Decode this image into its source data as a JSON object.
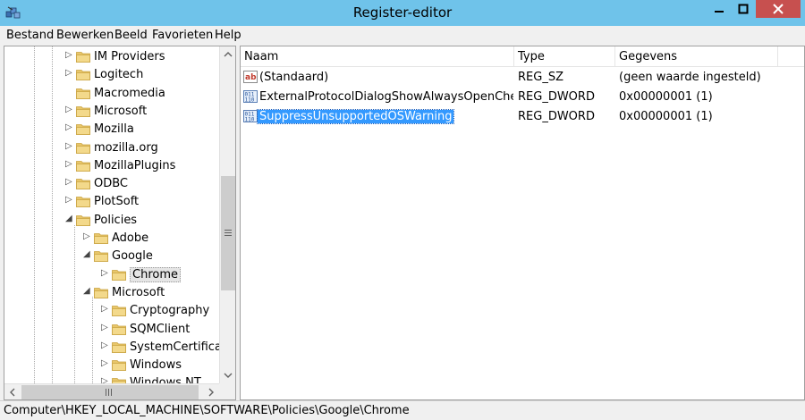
{
  "window": {
    "title": "Register-editor"
  },
  "menu": {
    "items": [
      "Bestand",
      "Bewerken",
      "Beeld",
      "Favorieten",
      "Help"
    ]
  },
  "tree": {
    "items": [
      {
        "label": "IM Providers",
        "expanded": false
      },
      {
        "label": "Logitech",
        "expanded": false
      },
      {
        "label": "Macromedia",
        "expanded": null
      },
      {
        "label": "Microsoft",
        "expanded": false
      },
      {
        "label": "Mozilla",
        "expanded": false
      },
      {
        "label": "mozilla.org",
        "expanded": false
      },
      {
        "label": "MozillaPlugins",
        "expanded": false
      },
      {
        "label": "ODBC",
        "expanded": false
      },
      {
        "label": "PlotSoft",
        "expanded": false
      },
      {
        "label": "Policies",
        "expanded": true
      },
      {
        "label": "Adobe",
        "expanded": false
      },
      {
        "label": "Google",
        "expanded": true
      },
      {
        "label": "Chrome",
        "expanded": false,
        "selected": true
      },
      {
        "label": "Microsoft",
        "expanded": true
      },
      {
        "label": "Cryptography",
        "expanded": false
      },
      {
        "label": "SQMClient",
        "expanded": false
      },
      {
        "label": "SystemCertificates",
        "expanded": false
      },
      {
        "label": "Windows",
        "expanded": false
      },
      {
        "label": "Windows NT",
        "expanded": false
      }
    ]
  },
  "values": {
    "columns": [
      "Naam",
      "Type",
      "Gegevens"
    ],
    "rows": [
      {
        "name": "(Standaard)",
        "type": "REG_SZ",
        "data": "(geen waarde ingesteld)",
        "icon": "string-value-icon"
      },
      {
        "name": "ExternalProtocolDialogShowAlwaysOpenCheck...",
        "type": "REG_DWORD",
        "data": "0x00000001 (1)",
        "icon": "dword-value-icon"
      },
      {
        "name": "SuppressUnsupportedOSWarning",
        "type": "REG_DWORD",
        "data": "0x00000001 (1)",
        "icon": "dword-value-icon",
        "selected": true
      }
    ]
  },
  "status": {
    "path": "Computer\\HKEY_LOCAL_MACHINE\\SOFTWARE\\Policies\\Google\\Chrome"
  },
  "colors": {
    "titlebar": "#6fc3ea",
    "close": "#c7504f",
    "selection": "#3399ff",
    "folder": "#e8c66a"
  }
}
